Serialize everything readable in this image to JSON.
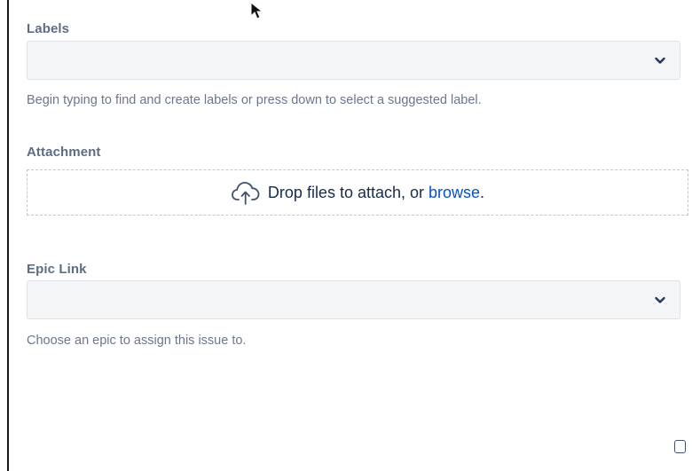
{
  "labels_field": {
    "label": "Labels",
    "value": "",
    "helper": "Begin typing to find and create labels or press down to select a suggested label."
  },
  "attachment_field": {
    "label": "Attachment",
    "drop_text": "Drop files to attach, or ",
    "browse_label": "browse",
    "drop_suffix": "."
  },
  "epic_link_field": {
    "label": "Epic Link",
    "value": "",
    "helper": "Choose an epic to assign this issue to."
  },
  "icons": {
    "dropdown": "chevron-down-icon",
    "upload": "cloud-upload-icon",
    "cursor": "mouse-pointer-icon"
  },
  "colors": {
    "link": "#0052cc",
    "label": "#5e6c84",
    "helper": "#6b778c",
    "field_bg": "#f4f5f7"
  }
}
